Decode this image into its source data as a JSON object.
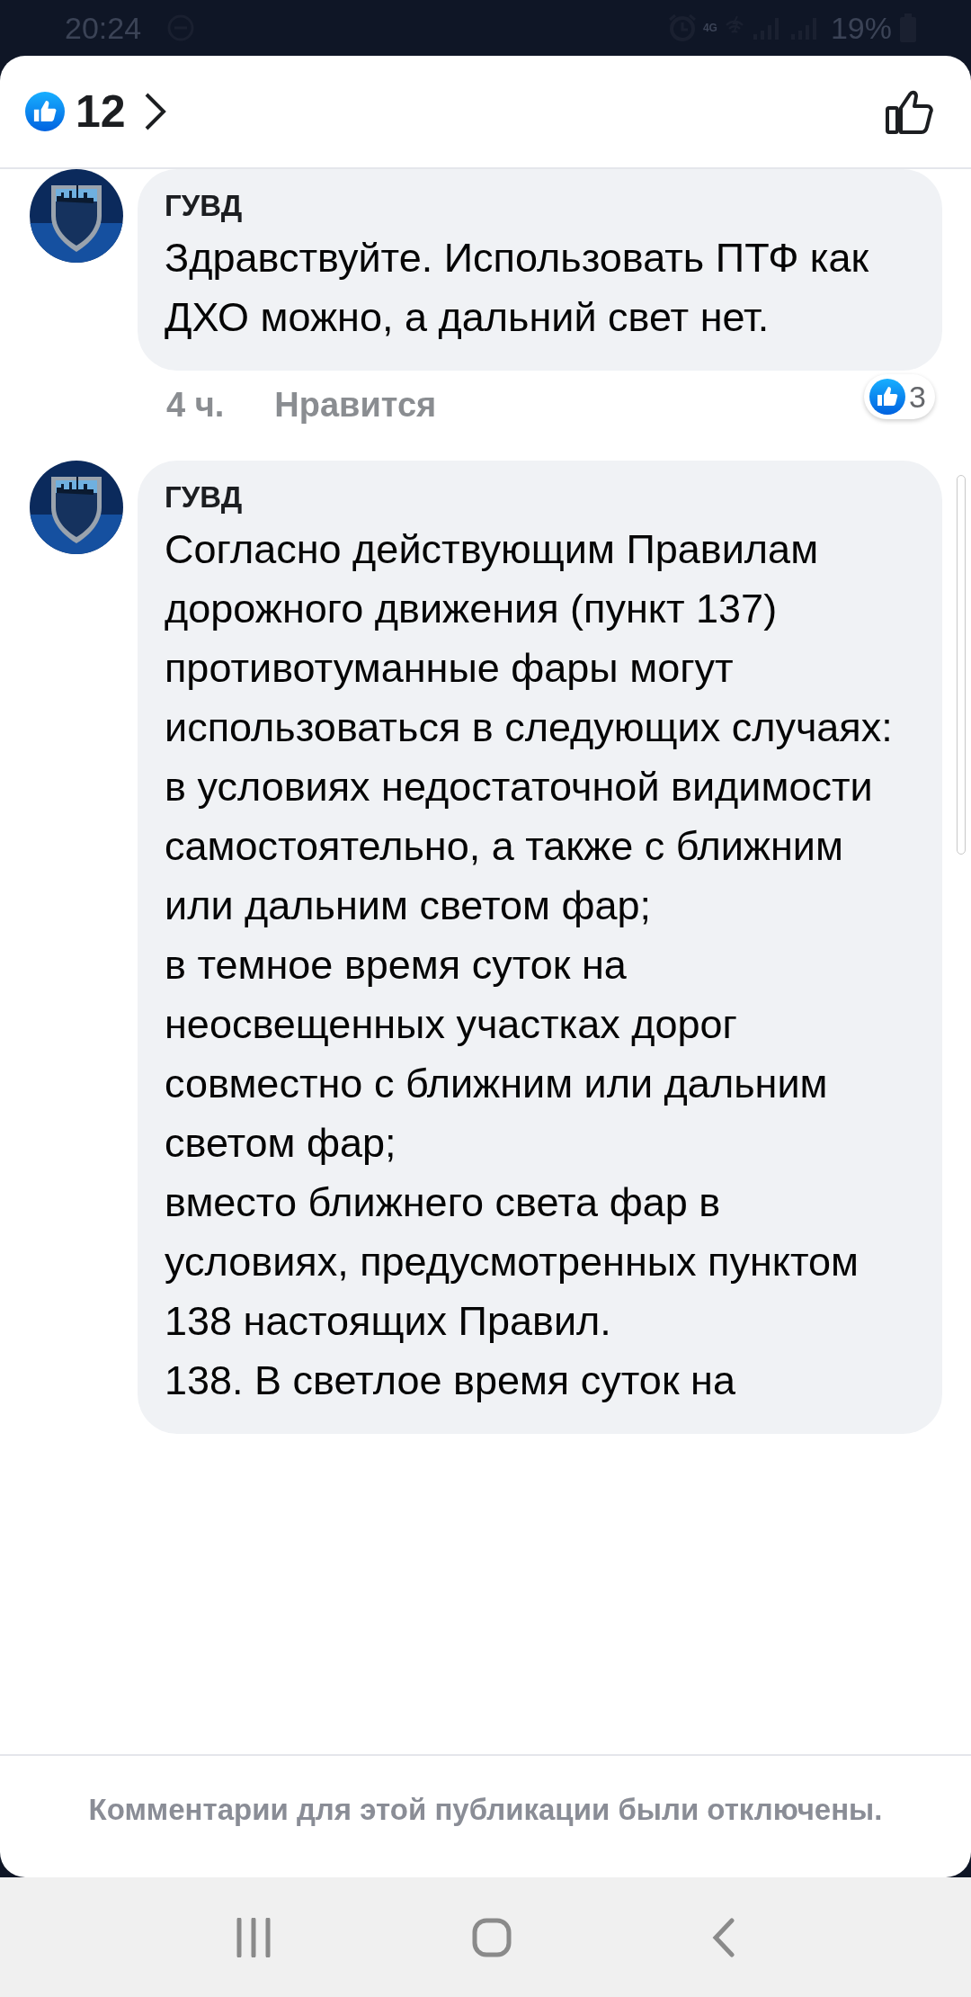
{
  "status_bar": {
    "time": "20:24",
    "network": "4G",
    "battery": "19%"
  },
  "header": {
    "reaction_count": "12"
  },
  "comments": [
    {
      "author": "ГУВД",
      "text": "Здравствуйте. Использовать ПТФ как ДХО можно, а дальний свет нет.",
      "time": "4 ч.",
      "like_label": "Нравится",
      "reactions": "3"
    },
    {
      "author": "ГУВД",
      "text": "Согласно действующим Правилам дорожного движения (пункт 137) противотуманные фары могут использоваться в следующих случаях:\nв условиях недостаточной видимости самостоятельно, а также с ближним или дальним светом фар;\nв темное время суток на неосвещенных участках дорог совместно с ближним или дальним светом фар;\nвместо ближнего света фар в условиях, предусмотренных пунктом 138 настоящих Правил.\n138. В светлое время суток на"
    }
  ],
  "footer": {
    "notice": "Комментарии для этой публикации были отключены."
  }
}
